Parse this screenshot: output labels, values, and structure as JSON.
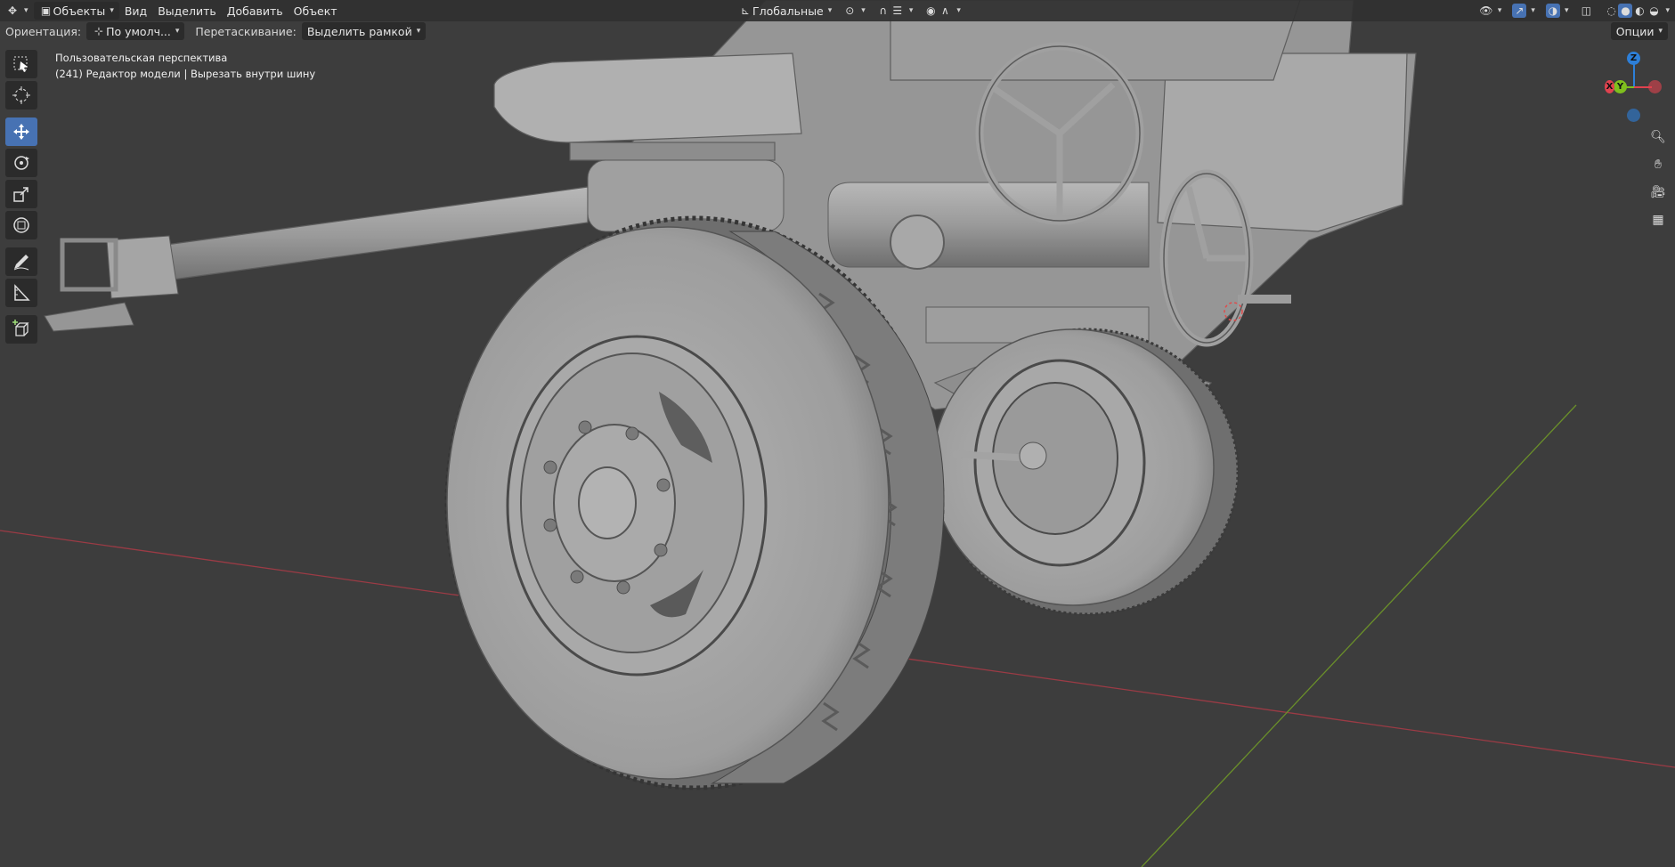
{
  "header": {
    "mode_label": "Объекты",
    "menus": [
      "Вид",
      "Выделить",
      "Добавить",
      "Объект"
    ],
    "transform_orientation": "Глобальные",
    "options_label": "Опции"
  },
  "tool_settings": {
    "orientation_label": "Ориентация:",
    "orientation_value": "По умолч...",
    "drag_label": "Перетаскивание:",
    "drag_value": "Выделить рамкой"
  },
  "viewport": {
    "view_name": "Пользовательская перспектива",
    "object_info": "(241) Редактор модели | Вырезать внутри шину"
  },
  "toolbar": {
    "tools": [
      "select-box",
      "cursor",
      "move",
      "rotate",
      "scale",
      "transform",
      "annotate",
      "measure",
      "add-cube"
    ],
    "active_tool": "move"
  },
  "gizmo": {
    "axes": [
      "Z",
      "Y",
      "X"
    ],
    "colors": {
      "x": "#e0424f",
      "y": "#7fbf1e",
      "z": "#2d7fd8"
    }
  },
  "nav_buttons": [
    "zoom",
    "pan",
    "camera",
    "ortho-toggle"
  ],
  "colors": {
    "background": "#3d3d3d",
    "accent": "#4772b3",
    "model": "#a8a8a8"
  }
}
